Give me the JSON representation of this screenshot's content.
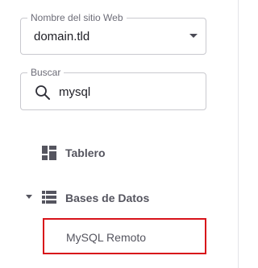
{
  "site_select": {
    "label": "Nombre del sitio Web",
    "value": "domain.tld"
  },
  "search": {
    "label": "Buscar",
    "value": "mysql"
  },
  "nav": {
    "dashboard_label": "Tablero",
    "databases_label": "Bases de Datos",
    "databases_expanded": true,
    "databases_children": [
      "MySQL Remoto"
    ]
  },
  "icons": {
    "select_caret": "chevron-down-icon",
    "search": "search-icon",
    "dashboard": "dashboard-icon",
    "databases": "database-list-icon",
    "expand": "caret-down-icon"
  },
  "colors": {
    "highlight_border": "#d8131a",
    "nav_text": "#55555f"
  }
}
